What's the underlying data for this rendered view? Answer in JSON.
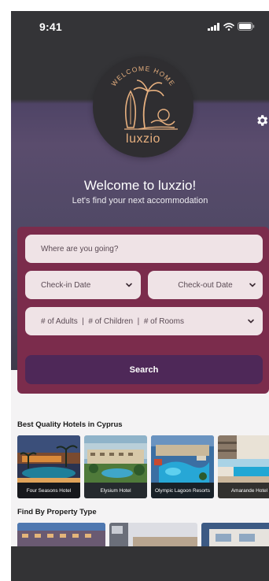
{
  "status_bar": {
    "time": "9:41"
  },
  "logo": {
    "tagline": "WELCOME HOME",
    "name": "luxzio"
  },
  "welcome": {
    "title": "Welcome to luxzio!",
    "subtitle": "Let's find your next accommodation"
  },
  "search": {
    "destination_placeholder": "Where are you going?",
    "checkin_label": "Check-in Date",
    "checkout_label": "Check-out Date",
    "guests_label": "# of Adults  |  # of Children  |  # of Rooms",
    "button_label": "Search"
  },
  "hotels": {
    "title": "Best Quality Hotels in Cyprus",
    "items": [
      {
        "name": "Four Seasons Hotel"
      },
      {
        "name": "Elysium Hotel"
      },
      {
        "name": "Olympic Lagoon Resorts"
      },
      {
        "name": "Amarande Hotel"
      }
    ]
  },
  "property_types": {
    "title": "Find By Property Type"
  },
  "icons": {
    "signal": "signal-icon",
    "wifi": "wifi-icon",
    "battery": "battery-icon",
    "settings": "gear-icon",
    "chevron": "chevron-down-icon"
  },
  "colors": {
    "card_bg": "#7b2c4c",
    "button_bg": "#4e2858",
    "field_bg": "#efe3e6",
    "logo_gold": "#e7b07f",
    "dark_header": "#343437"
  }
}
